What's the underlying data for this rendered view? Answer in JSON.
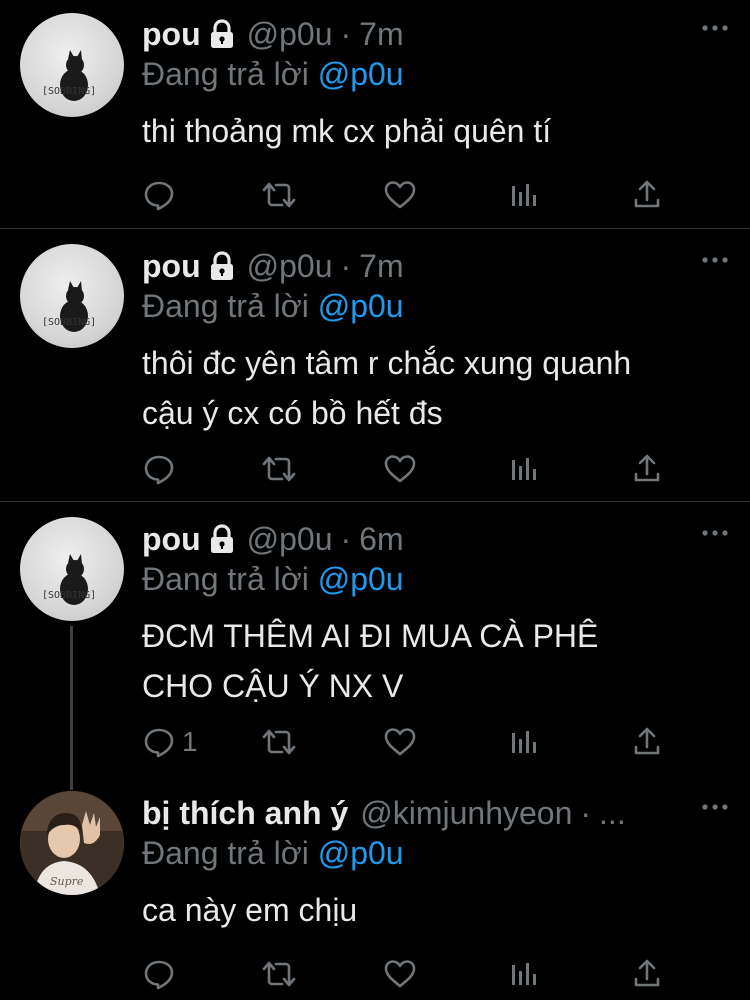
{
  "tweets": [
    {
      "name": "pou",
      "handle": "@p0u",
      "separator": "·",
      "time": "7m",
      "reply_prefix": "Đang trả lời",
      "reply_to": "@p0u",
      "text_lines": [
        "thi thoảng mk cx phải quên tí"
      ],
      "avatar_label": "[SOBBING]",
      "reply_count": ""
    },
    {
      "name": "pou",
      "handle": "@p0u",
      "separator": "·",
      "time": "7m",
      "reply_prefix": "Đang trả lời",
      "reply_to": "@p0u",
      "text_lines": [
        "thôi đc yên tâm r chắc xung quanh",
        "cậu ý cx có bồ hết đs"
      ],
      "avatar_label": "[SOBBING]",
      "reply_count": ""
    },
    {
      "name": "pou",
      "handle": "@p0u",
      "separator": "·",
      "time": "6m",
      "reply_prefix": "Đang trả lời",
      "reply_to": "@p0u",
      "text_lines": [
        "ĐCM THÊM AI ĐI MUA CÀ PHÊ",
        "CHO CẬU Ý NX V"
      ],
      "avatar_label": "[SOBBING]",
      "reply_count": "1"
    },
    {
      "name": "bị thích anh ý",
      "handle": "@kimjunhyeon",
      "separator": "·",
      "time": "...",
      "reply_prefix": "Đang trả lời",
      "reply_to": "@p0u",
      "text_lines": [
        "ca này em chịu"
      ],
      "avatar_label": "",
      "reply_count": ""
    }
  ],
  "icons": {
    "reply": "reply-icon",
    "retweet": "retweet-icon",
    "like": "heart-icon",
    "views": "analytics-icon",
    "share": "share-icon",
    "more": "more-icon",
    "lock": "lock-icon"
  },
  "colors": {
    "background": "#000000",
    "text": "#e7e9ea",
    "secondary": "#71767b",
    "accent": "#1d9bf0",
    "divider": "#2f3336"
  }
}
